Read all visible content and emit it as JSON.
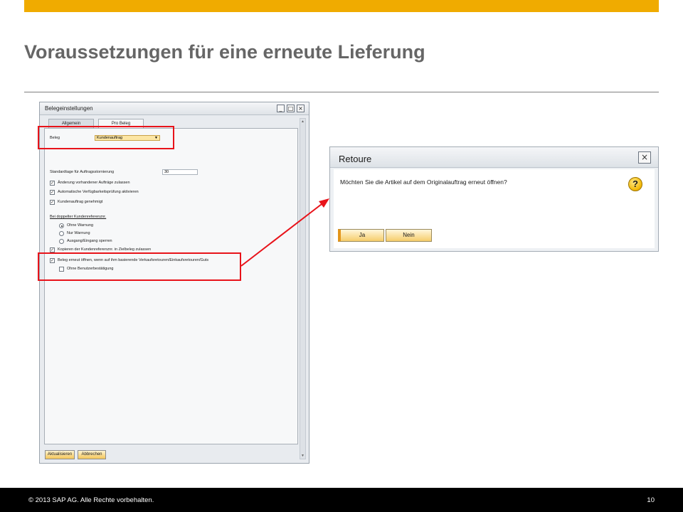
{
  "slide": {
    "title": "Voraussetzungen für eine erneute Lieferung",
    "copyright": "© 2013 SAP AG. Alle Rechte vorbehalten.",
    "page_number": "10",
    "accent_color": "#f0ab00",
    "highlight_color": "#e8131a"
  },
  "belegeinstellungen": {
    "title": "Belegeinstellungen",
    "tabs": [
      {
        "label": "Allgemein",
        "active": false
      },
      {
        "label": "Pro Beleg",
        "active": true
      }
    ],
    "beleg_label": "Beleg",
    "beleg_value": "Kundenauftrag",
    "standardtage_label": "Standardtage für Auftragsstornierung",
    "standardtage_value": "30",
    "checkboxes": [
      {
        "label": "Änderung vorhandener Aufträge zulassen",
        "checked": true
      },
      {
        "label": "Automatische Verfügbarkeitsprüfung aktivieren",
        "checked": true
      },
      {
        "label": "Kundenauftrag genehmigt",
        "checked": true
      }
    ],
    "doppelter_heading": "Bei doppelter Kundenreferenznr.",
    "radios": [
      {
        "label": "Ohne Warnung",
        "selected": true
      },
      {
        "label": "Nur Warnung",
        "selected": false
      },
      {
        "label": "Ausgang/Eingang sperren",
        "selected": false
      }
    ],
    "kopieren_label": "Kopieren der Kundenreferenznr. in Zielbeleg zulassen",
    "kopieren_checked": true,
    "beleg_erneut_label": "Beleg erneut öffnen, wenn auf ihm basierende Verkaufsretouren/Einkaufsretouren/Guts",
    "beleg_erneut_checked": true,
    "ohne_bestaetigung_label": "Ohne Benutzerbestätigung",
    "ohne_bestaetigung_checked": false,
    "buttons": {
      "update": "Aktualisieren",
      "cancel": "Abbrechen"
    }
  },
  "retoure_dialog": {
    "title": "Retoure",
    "message": "Möchten Sie die Artikel auf dem Originalauftrag erneut öffnen?",
    "icon": "help-icon",
    "yes_label": "Ja",
    "no_label": "Nein"
  }
}
